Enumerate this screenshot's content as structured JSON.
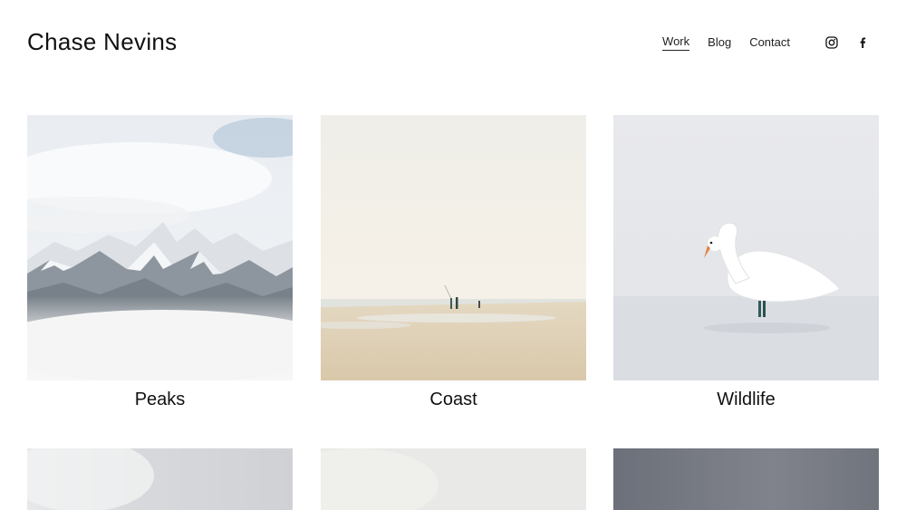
{
  "site": {
    "title": "Chase Nevins"
  },
  "nav": {
    "items": [
      {
        "label": "Work",
        "active": true
      },
      {
        "label": "Blog",
        "active": false
      },
      {
        "label": "Contact",
        "active": false
      }
    ],
    "social": [
      {
        "icon": "instagram-icon"
      },
      {
        "icon": "facebook-icon"
      }
    ]
  },
  "gallery": {
    "items": [
      {
        "caption": "Peaks"
      },
      {
        "caption": "Coast"
      },
      {
        "caption": "Wildlife"
      }
    ]
  },
  "colors": {
    "text": "#111111",
    "background": "#ffffff"
  }
}
